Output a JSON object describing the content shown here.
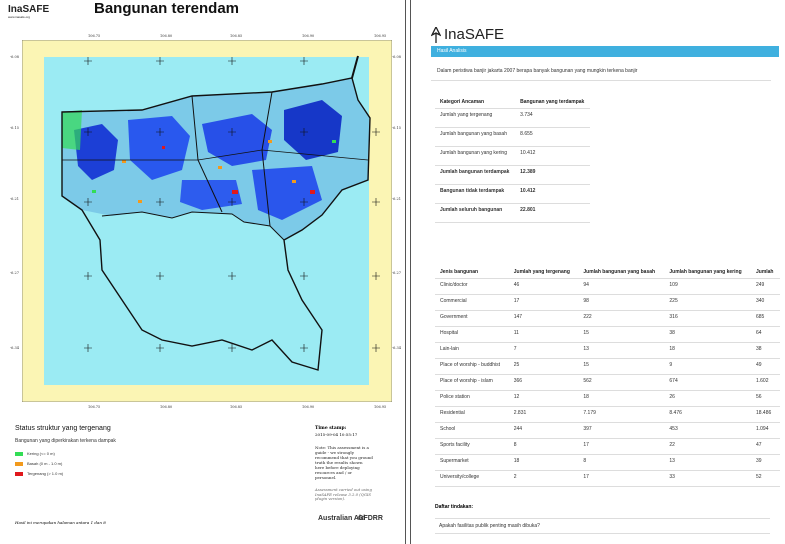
{
  "map_page": {
    "logo": {
      "name": "InaSAFE",
      "sub": "www.inasafe.org"
    },
    "title": "Bangunan terendam",
    "top_ticks": [
      "106.75",
      "106.80",
      "106.85",
      "106.90",
      "106.95"
    ],
    "bottom_ticks": [
      "106.75",
      "106.80",
      "106.85",
      "106.90",
      "106.95"
    ],
    "left_ticks": [
      "-6.08",
      "-6.15",
      "-6.21",
      "-6.27",
      "-6.34"
    ],
    "right_ticks": [
      "-6.08",
      "-6.15",
      "-6.21",
      "-6.27",
      "-6.34"
    ],
    "status_title": "Status struktur yang tergenang",
    "status_subtitle": "Bangunan yang diperkirakan terkena dampak",
    "legend": [
      {
        "label": "Kering  (<= 0 m)",
        "color": "#33dd55"
      },
      {
        "label": "Basah  (0 m - 1.0 m)",
        "color": "#f29a1d"
      },
      {
        "label": "Tergenang  (> 1.0 m)",
        "color": "#e0181c"
      }
    ],
    "timestamp_label": "Time stamp:",
    "timestamp_value": "2015-09-04 10:55:17",
    "note": "Note: This assessment is a guide - we strongly recommend that you ground truth the results shown here before deploying resources and / or personnel.",
    "assessment": "Assessment carried out using InaSAFE release 3.2.0 (QGIS plugin version).",
    "page_footer": "Hasil ini merupakan halaman antara 1 dan 8",
    "sponsor_1": "Australian Aid",
    "sponsor_2": "GFDRR"
  },
  "report_page": {
    "logo": "InaSAFE",
    "band_title": "Hasil Analisis",
    "intro": "Dalam peristiwa banjir jakarta 2007 berapa banyak bangunan yang mungkin terkena banjir",
    "summary_headers": [
      "Kategori Ancaman",
      "Bangunan yang terdampak"
    ],
    "summary_rows": [
      [
        "Jumlah yang tergenang",
        "3.734"
      ],
      [
        "Jumlah bangunan yang basah",
        "8.655"
      ],
      [
        "Jumlah bangunan yang kering",
        "10.412"
      ],
      [
        "Jumlah bangunan terdampak",
        "12.389"
      ],
      [
        "Bangunan tidak terdampak",
        "10.412"
      ],
      [
        "Jumlah seluruh bangunan",
        "22.801"
      ]
    ],
    "detail_headers": [
      "Jenis bangunan",
      "Jumlah yang tergenang",
      "Jumlah bangunan yang basah",
      "Jumlah bangunan yang kering",
      "Jumlah"
    ],
    "detail_rows": [
      [
        "Clinic/doctor",
        "46",
        "94",
        "109",
        "249"
      ],
      [
        "Commercial",
        "17",
        "98",
        "225",
        "340"
      ],
      [
        "Government",
        "147",
        "222",
        "316",
        "685"
      ],
      [
        "Hospital",
        "11",
        "15",
        "38",
        "64"
      ],
      [
        "Lain-lain",
        "7",
        "13",
        "18",
        "38"
      ],
      [
        "Place of worship - buddhist",
        "25",
        "15",
        "9",
        "49"
      ],
      [
        "Place of worship - islam",
        "366",
        "562",
        "674",
        "1.602"
      ],
      [
        "Police station",
        "12",
        "18",
        "26",
        "56"
      ],
      [
        "Residential",
        "2.831",
        "7.179",
        "8.476",
        "18.486"
      ],
      [
        "School",
        "244",
        "397",
        "453",
        "1.094"
      ],
      [
        "Sports facility",
        "8",
        "17",
        "22",
        "47"
      ],
      [
        "Supermarket",
        "18",
        "8",
        "13",
        "39"
      ],
      [
        "University/college",
        "2",
        "17",
        "33",
        "52"
      ]
    ],
    "actions_title": "Daftar tindakan:",
    "actions_question": "Apakah fasilitas publik penting masih dibuka?"
  }
}
